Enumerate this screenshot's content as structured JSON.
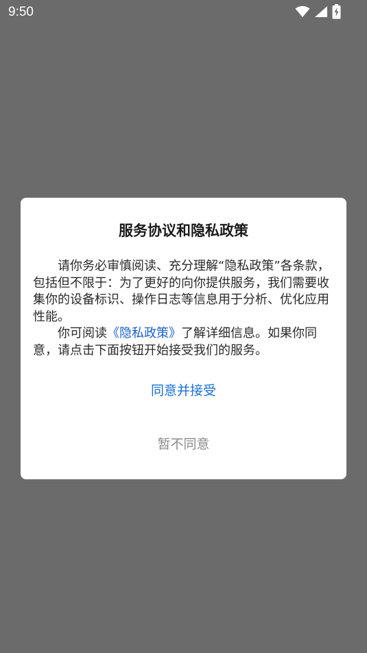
{
  "status_bar": {
    "time": "9:50",
    "icons": [
      "wifi-icon",
      "signal-icon",
      "battery-charging-icon"
    ]
  },
  "dialog": {
    "title": "服务协议和隐私政策",
    "paragraph1": "请你务必审慎阅读、充分理解“隐私政策”各条款，包括但不限于：为了更好的向你提供服务，我们需要收集你的设备标识、操作日志等信息用于分析、优化应用性能。",
    "paragraph2_prefix": "你可阅读",
    "paragraph2_link": "《隐私政策》",
    "paragraph2_suffix": "了解详细信息。如果你同意，请点击下面按钮开始接受我们的服务。",
    "agree_label": "同意并接受",
    "decline_label": "暂不同意"
  },
  "colors": {
    "overlay": "#6b6b6b",
    "dialog_bg": "#ffffff",
    "link": "#1a5fd0",
    "agree": "#1a6fd6",
    "decline": "#8a8a8a"
  }
}
